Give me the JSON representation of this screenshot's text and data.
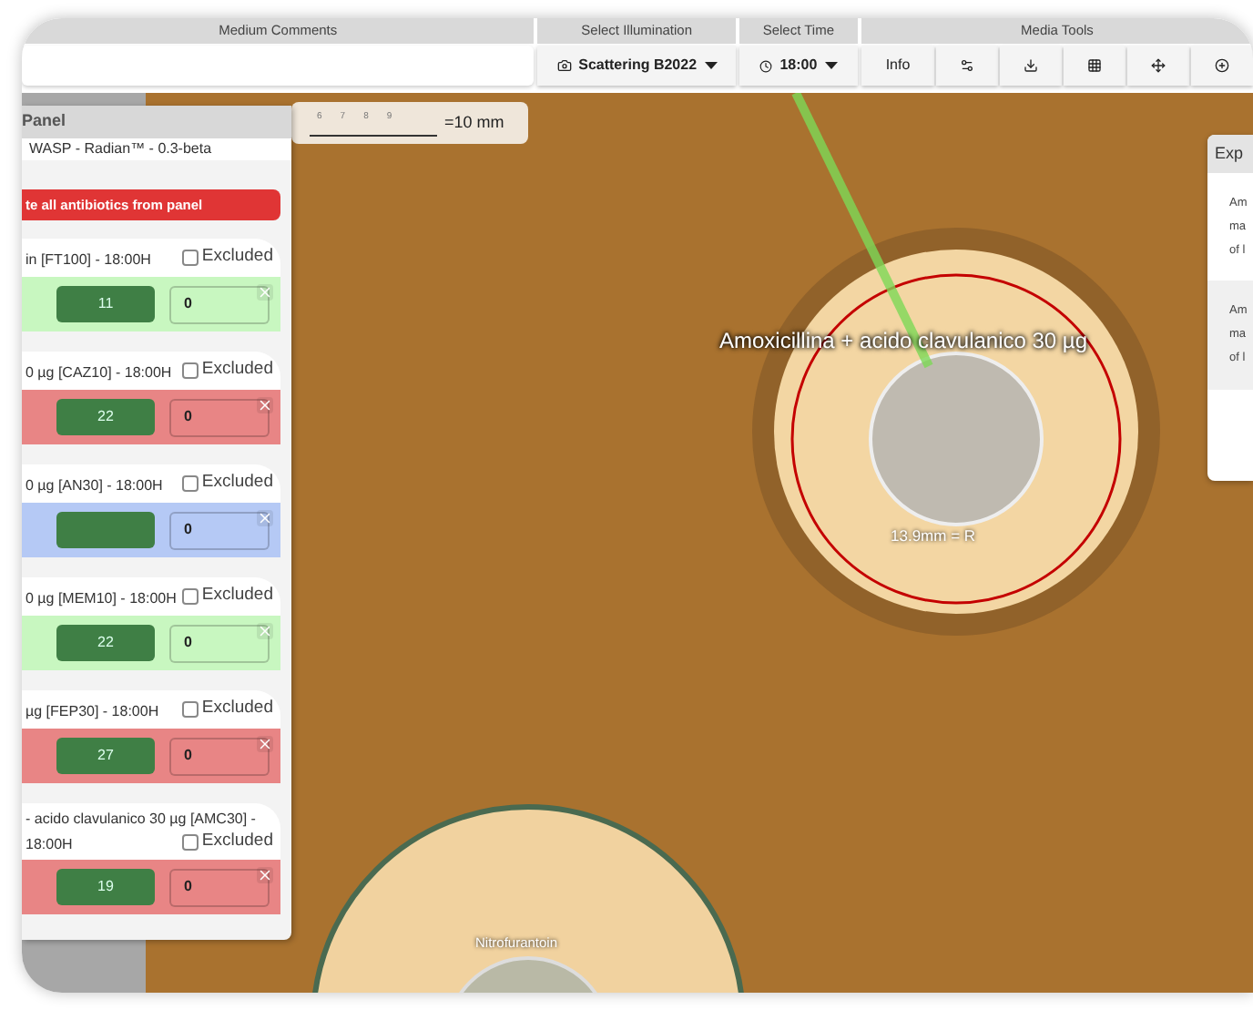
{
  "header": {
    "medium_comments": {
      "label": "Medium Comments"
    },
    "illumination": {
      "label": "Select Illumination",
      "value": "Scattering B2022"
    },
    "time": {
      "label": "Select Time",
      "value": "18:00"
    },
    "media_tools": {
      "label": "Media Tools",
      "info_button": "Info"
    }
  },
  "scale_bar": {
    "ticks": [
      "6",
      "7",
      "8",
      "9"
    ],
    "label": "=10 mm"
  },
  "plate_labels": {
    "zone_label": "Amoxicillina + acido clavulanico 30 µg",
    "zone_reading": "13.9mm = R",
    "second_label": "Nitrofurantoin"
  },
  "panel": {
    "title": "Panel",
    "subtitle": "WASP - Radian™ - 0.3-beta",
    "remove_button": "te all antibiotics from panel",
    "antibiotics": [
      {
        "name": "in [FT100] - 18:00H",
        "excluded_label": "Excluded",
        "excluded": false,
        "diameter": "11",
        "value": "0",
        "color": "#c8f7c0"
      },
      {
        "name": "0 µg [CAZ10] - 18:00H",
        "excluded_label": "Excluded",
        "excluded": false,
        "diameter": "22",
        "value": "0",
        "color": "#e88585"
      },
      {
        "name": "0 µg [AN30] - 18:00H",
        "excluded_label": "Excluded",
        "excluded": false,
        "value": "0",
        "color": "#b5c9f5"
      },
      {
        "name": "0 µg [MEM10] - 18:00H",
        "excluded_label": "Excluded",
        "excluded": false,
        "diameter": "22",
        "value": "0",
        "color": "#c8f7c0"
      },
      {
        "name": "µg [FEP30] - 18:00H",
        "excluded_label": "Excluded",
        "excluded": false,
        "diameter": "27",
        "value": "0",
        "color": "#e88585"
      },
      {
        "name": "- acido clavulanico 30 µg [AMC30] -",
        "time": "18:00H",
        "excluded_label": "Excluded",
        "excluded": false,
        "diameter": "19",
        "value": "0",
        "color": "#e88585"
      }
    ]
  },
  "explanation_panel": {
    "title": "Exp",
    "sections": [
      {
        "lines": [
          "Am",
          "ma",
          "of l"
        ]
      },
      {
        "lines": [
          "Am",
          "ma",
          "of l"
        ]
      }
    ]
  }
}
